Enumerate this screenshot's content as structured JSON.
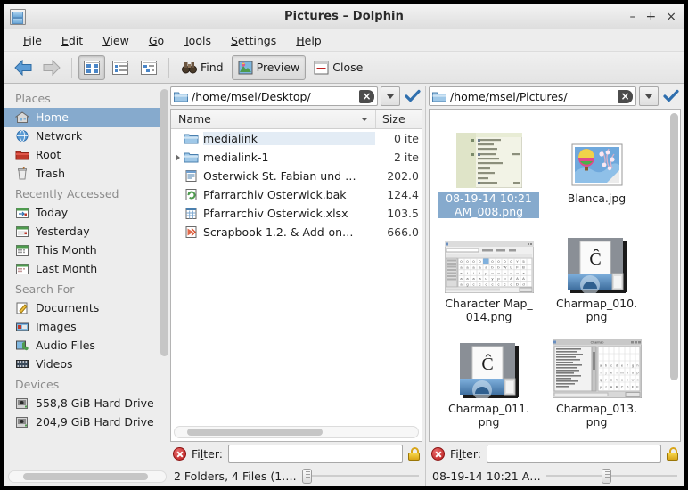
{
  "window": {
    "title": "Pictures – Dolphin",
    "app_icon": "file-cabinet-icon",
    "minimize": "–",
    "maximize": "+",
    "close": "×"
  },
  "menubar": [
    {
      "label": "File",
      "accel": "F"
    },
    {
      "label": "Edit",
      "accel": "E"
    },
    {
      "label": "View",
      "accel": "V"
    },
    {
      "label": "Go",
      "accel": "G"
    },
    {
      "label": "Tools",
      "accel": "T"
    },
    {
      "label": "Settings",
      "accel": "S"
    },
    {
      "label": "Help",
      "accel": "H"
    }
  ],
  "toolbar": {
    "back": "back-arrow",
    "forward": "forward-arrow",
    "view_icons": "icons-view",
    "view_compact": "compact-view",
    "view_details": "details-view",
    "find_label": "Find",
    "preview_label": "Preview",
    "close_label": "Close"
  },
  "sidebar": {
    "sections": [
      {
        "title": "Places",
        "items": [
          {
            "label": "Home",
            "icon": "home-icon",
            "selected": true
          },
          {
            "label": "Network",
            "icon": "network-globe-icon",
            "selected": false
          },
          {
            "label": "Root",
            "icon": "root-folder-icon",
            "selected": false
          },
          {
            "label": "Trash",
            "icon": "trash-icon",
            "selected": false
          }
        ]
      },
      {
        "title": "Recently Accessed",
        "items": [
          {
            "label": "Today",
            "icon": "calendar-today-icon",
            "selected": false
          },
          {
            "label": "Yesterday",
            "icon": "calendar-yesterday-icon",
            "selected": false
          },
          {
            "label": "This Month",
            "icon": "calendar-month-icon",
            "selected": false
          },
          {
            "label": "Last Month",
            "icon": "calendar-last-month-icon",
            "selected": false
          }
        ]
      },
      {
        "title": "Search For",
        "items": [
          {
            "label": "Documents",
            "icon": "documents-icon",
            "selected": false
          },
          {
            "label": "Images",
            "icon": "images-icon",
            "selected": false
          },
          {
            "label": "Audio Files",
            "icon": "audio-icon",
            "selected": false
          },
          {
            "label": "Videos",
            "icon": "video-icon",
            "selected": false
          }
        ]
      },
      {
        "title": "Devices",
        "items": [
          {
            "label": "558,8 GiB Hard Drive",
            "icon": "hard-drive-icon",
            "selected": false
          },
          {
            "label": "204,9 GiB Hard Drive",
            "icon": "hard-drive-icon",
            "selected": false
          }
        ]
      }
    ]
  },
  "left_pane": {
    "url": "/home/msel/Desktop/",
    "columns": {
      "name": "Name",
      "size": "Size"
    },
    "rows": [
      {
        "name": "medialink",
        "size": "0 ite",
        "icon": "folder-icon",
        "expandable": false,
        "highlighted": true
      },
      {
        "name": "medialink-1",
        "size": "2 ite",
        "icon": "folder-icon",
        "expandable": true,
        "highlighted": false
      },
      {
        "name": "Osterwick St. Fabian und …",
        "size": "202.0",
        "icon": "document-icon",
        "expandable": false,
        "highlighted": false
      },
      {
        "name": "Pfarrarchiv Osterwick.bak",
        "size": "124.4",
        "icon": "backup-icon",
        "expandable": false,
        "highlighted": false
      },
      {
        "name": "Pfarrarchiv Osterwick.xlsx",
        "size": "103.5",
        "icon": "spreadsheet-icon",
        "expandable": false,
        "highlighted": false
      },
      {
        "name": "Scrapbook 1.2. & Add-on…",
        "size": "666.0",
        "icon": "archive-icon",
        "expandable": false,
        "highlighted": false
      }
    ],
    "filter_label": "Filter:",
    "filter_value": "",
    "status": "2 Folders, 4 Files (1…."
  },
  "right_pane": {
    "url": "/home/msel/Pictures/",
    "items": [
      {
        "label": "08-19-14 10:21 AM_008.png",
        "thumb": "screenshot-menu-thumb",
        "selected": true
      },
      {
        "label": "Blanca.jpg",
        "thumb": "balloon-photo-thumb",
        "selected": false
      },
      {
        "label": "Character Map_ 014.png",
        "thumb": "charmap-window-thumb",
        "selected": false
      },
      {
        "label": "Charmap_010. png",
        "thumb": "charmap-dialog-thumb",
        "selected": false
      },
      {
        "label": "Charmap_011. png",
        "thumb": "charmap-dialog-thumb",
        "selected": false
      },
      {
        "label": "Charmap_013. png",
        "thumb": "charmap-grid-thumb",
        "selected": false
      }
    ],
    "filter_label": "Filter:",
    "filter_value": "",
    "status": "08-19-14 10:21 A…"
  },
  "colors": {
    "selection": "#86aacd",
    "window_bg": "#ededed",
    "pane_bg": "#ffffff",
    "accent_check": "#2f6fae"
  }
}
